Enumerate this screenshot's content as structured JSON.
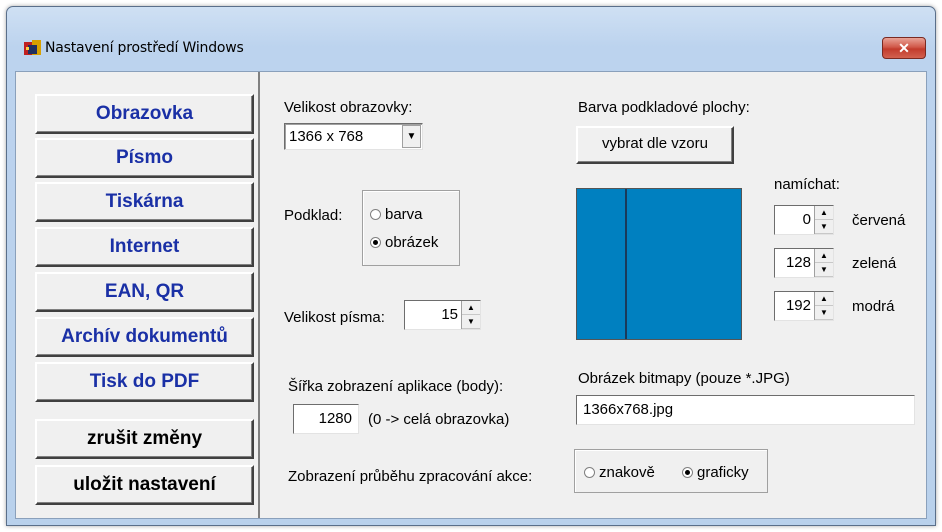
{
  "window": {
    "title": "Nastavení prostředí Windows",
    "close_label": "✕"
  },
  "nav": {
    "items": [
      {
        "label": "Obrazovka"
      },
      {
        "label": "Písmo"
      },
      {
        "label": "Tiskárna"
      },
      {
        "label": "Internet"
      },
      {
        "label": "EAN, QR"
      },
      {
        "label": "Archív dokumentů"
      },
      {
        "label": "Tisk do PDF"
      }
    ],
    "cancel_label": "zrušit změny",
    "save_label": "uložit nastavení"
  },
  "screen_size": {
    "label": "Velikost obrazovky:",
    "value": "1366 x 768"
  },
  "background": {
    "label": "Podklad:",
    "options": [
      "barva",
      "obrázek"
    ],
    "selected": "obrázek"
  },
  "font_size": {
    "label": "Velikost písma:",
    "value": "15"
  },
  "app_width": {
    "label": "Šířka zobrazení aplikace (body):",
    "value": "1280",
    "hint": "(0 -> celá obrazovka)"
  },
  "progress_display": {
    "label": "Zobrazení průběhu zpracování akce:",
    "options": [
      "znakově",
      "graficky"
    ],
    "selected": "graficky"
  },
  "bg_color": {
    "label": "Barva podkladové plochy:",
    "pick_button": "vybrat dle vzoru",
    "mix_label": "namíchat:",
    "red": {
      "value": "0",
      "label": "červená"
    },
    "green": {
      "value": "128",
      "label": "zelená"
    },
    "blue": {
      "value": "192",
      "label": "modrá"
    },
    "swatch_color": "#0080c0"
  },
  "bitmap": {
    "label": "Obrázek bitmapy (pouze *.JPG)",
    "value": "1366x768.jpg"
  }
}
